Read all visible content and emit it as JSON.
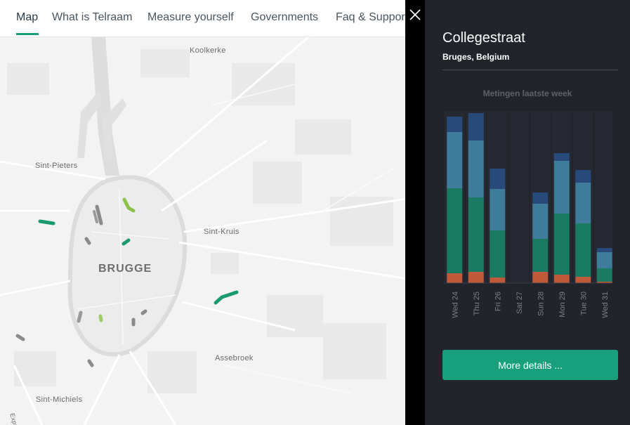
{
  "nav": {
    "items": [
      {
        "label": "Map",
        "active": true
      },
      {
        "label": "What is Telraam",
        "active": false
      },
      {
        "label": "Measure yourself",
        "active": false
      },
      {
        "label": "Governments",
        "active": false
      },
      {
        "label": "Faq & Support",
        "active": false
      }
    ]
  },
  "map": {
    "city_label": "BRUGGE",
    "labels": [
      "Koolkerke",
      "Sint-Pieters",
      "Sint-Kruis",
      "Assebroek",
      "Sint-Michiels",
      "Expressw"
    ]
  },
  "panel": {
    "street": "Collegestraat",
    "location": "Bruges, Belgium",
    "chart_title": "Metingen laatste week",
    "more_button": "More details ...",
    "close_icon": "close-icon"
  },
  "colors": {
    "accent": "#18a07c",
    "series": {
      "orange": "#c0583a",
      "green": "#1b7a62",
      "lightblue": "#3f7b9a",
      "darkblue": "#274a7a"
    }
  },
  "chart_data": {
    "type": "bar",
    "stacked": true,
    "title": "Metingen laatste week",
    "categories": [
      "Wed 24",
      "Thu 25",
      "Fri 26",
      "Sat 27",
      "Sun 28",
      "Mon 29",
      "Tue 30",
      "Wed 31"
    ],
    "series": [
      {
        "color": "#c0583a",
        "values": [
          14,
          16,
          8,
          0,
          16,
          12,
          9,
          2
        ]
      },
      {
        "color": "#1b7a62",
        "values": [
          121,
          106,
          67,
          0,
          47,
          87,
          76,
          19
        ]
      },
      {
        "color": "#3f7b9a",
        "values": [
          80,
          81,
          59,
          0,
          50,
          75,
          58,
          23
        ]
      },
      {
        "color": "#274a7a",
        "values": [
          22,
          39,
          29,
          0,
          16,
          11,
          18,
          6
        ]
      }
    ],
    "ylim": [
      0,
      245
    ],
    "grid": false,
    "legend": "none"
  }
}
